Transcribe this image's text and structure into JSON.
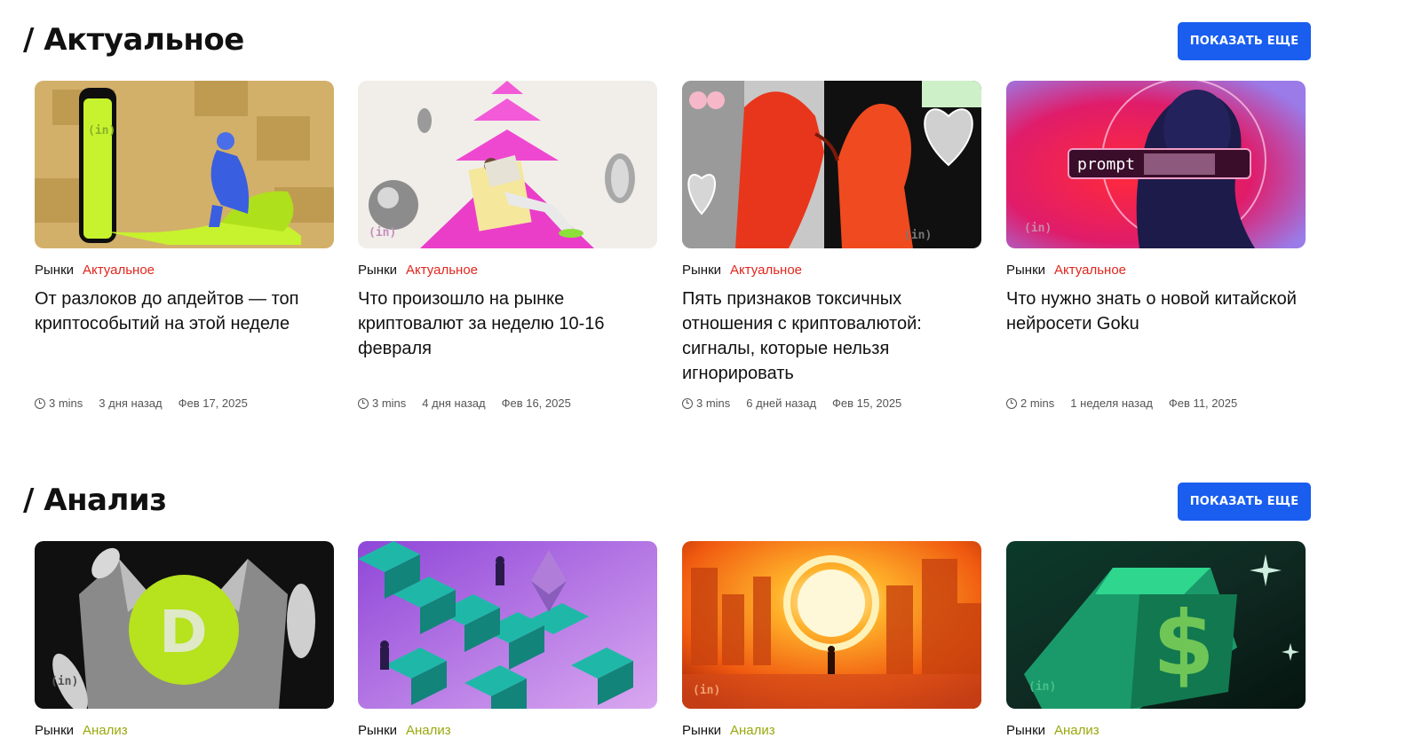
{
  "sections": [
    {
      "title": "/ Актуальное",
      "more_label": "ПОКАЗАТЬ ЕЩЕ",
      "cards": [
        {
          "category": "Рынки",
          "tag": "Актуальное",
          "title": "От разлоков до апдейтов — топ криптособытий на этой неделе",
          "read_time": "3 mins",
          "ago": "3 дня назад",
          "date": "Фев 17, 2025",
          "image": "thinker-phone"
        },
        {
          "category": "Рынки",
          "tag": "Актуальное",
          "title": "Что произошло на рынке криптовалют за неделю 10-16 февраля",
          "read_time": "3 mins",
          "ago": "4 дня назад",
          "date": "Фев 16, 2025",
          "image": "newspaper-reader"
        },
        {
          "category": "Рынки",
          "tag": "Актуальное",
          "title": "Пять признаков токсичных отношения с криптовалютой: сигналы, которые нельзя игнорировать",
          "read_time": "3 mins",
          "ago": "6 дней назад",
          "date": "Фев 15, 2025",
          "image": "kiss-hearts"
        },
        {
          "category": "Рынки",
          "tag": "Актуальное",
          "title": "Что нужно знать о новой китайской нейросети Goku",
          "read_time": "2 mins",
          "ago": "1 неделя назад",
          "date": "Фев 11, 2025",
          "image": "ai-prompt",
          "image_text": "prompt"
        }
      ]
    },
    {
      "title": "/ Анализ",
      "more_label": "ПОКАЗАТЬ ЕЩЕ",
      "cards": [
        {
          "category": "Рынки",
          "tag": "Анализ",
          "image": "doge-coin"
        },
        {
          "category": "Рынки",
          "tag": "Анализ",
          "image": "ethereum-blocks"
        },
        {
          "category": "Рынки",
          "tag": "Анализ",
          "image": "orange-sunset"
        },
        {
          "category": "Рынки",
          "tag": "Анализ",
          "image": "green-dollar"
        }
      ]
    }
  ],
  "watermark": "(in)",
  "colors": {
    "accent_button": "#1a5ef0",
    "tag_current": "#e0261e",
    "tag_analysis": "#9aa80c"
  }
}
